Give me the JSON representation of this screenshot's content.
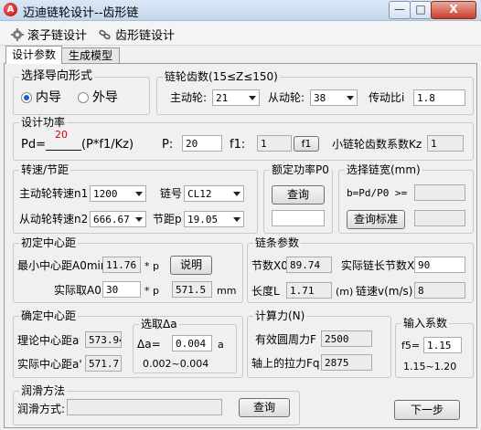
{
  "window": {
    "title": "迈迪链轮设计--齿形链",
    "min": "—",
    "max": "□",
    "close": "X"
  },
  "menu": {
    "roller": "滚子链设计",
    "tooth": "齿形链设计"
  },
  "tabs": {
    "design": "设计参数",
    "model": "生成模型"
  },
  "guide": {
    "title": "选择导向形式",
    "inner": "内导",
    "outer": "外导",
    "selected": "inner"
  },
  "teeth": {
    "title": "链轮齿数(15≤Z≤150)",
    "driver_label": "主动轮:",
    "driver_value": "21",
    "driven_label": "从动轮:",
    "driven_value": "38",
    "ratio_label": "传动比i",
    "ratio_value": "1.8"
  },
  "power": {
    "title": "设计功率",
    "formula_prefix": "Pd=",
    "formula_blank": "______",
    "formula_sup": "20",
    "formula_suffix": "(P*f1/Kz)",
    "p_label": "P:",
    "p_value": "20",
    "f1_label": "f1:",
    "f1_value": "1",
    "f1_btn": "f1",
    "kz_label": "小链轮齿数系数Kz",
    "kz_value": "1"
  },
  "speed": {
    "title": "转速/节距",
    "n1_label": "主动轮转速n1",
    "n1_value": "1200",
    "chain_label": "链号",
    "chain_value": "CL12",
    "n2_label": "从动轮转速n2",
    "n2_value": "666.67",
    "pitch_label": "节距p",
    "pitch_value": "19.05"
  },
  "rated": {
    "title": "额定功率P0",
    "query_btn": "查询"
  },
  "width": {
    "title": "选择链宽(mm)",
    "formula": "b=Pd/P0 >=",
    "query_btn": "查询标准"
  },
  "center_init": {
    "title": "初定中心距",
    "min_label": "最小中心距A0min",
    "min_value": "11.76",
    "min_unit": "* p",
    "explain_btn": "说明",
    "actual_label": "实际取A0",
    "actual_value": "30",
    "actual_unit": "* p",
    "actual_mm": "571.5",
    "mm": "mm"
  },
  "chain_params": {
    "title": "链条参数",
    "x0_label": "节数X0",
    "x0_value": "89.74",
    "x_label": "实际链长节数X",
    "x_value": "90",
    "l_label": "长度L",
    "l_value": "1.71",
    "l_unit": "(m)",
    "v_label": "链速v(m/s)",
    "v_value": "8"
  },
  "center_final": {
    "title": "确定中心距",
    "theory_label": "理论中心距a",
    "theory_value": "573.94",
    "actual_label": "实际中心距a'",
    "actual_value": "571.7"
  },
  "delta": {
    "title": "选取Δa",
    "label": "Δa=",
    "value": "0.004",
    "unit": "a",
    "range": "0.002~0.004"
  },
  "force": {
    "title": "计算力(N)",
    "f_label": "有效圆周力F",
    "f_value": "2500",
    "fq_label": "轴上的拉力Fq",
    "fq_value": "2875"
  },
  "coef": {
    "title": "输入系数",
    "f5_label": "f5=",
    "f5_value": "1.15",
    "range": "1.15~1.20"
  },
  "lube": {
    "title": "润滑方法",
    "label": "润滑方式:",
    "value": "",
    "query_btn": "查询"
  },
  "next_btn": "下一步"
}
